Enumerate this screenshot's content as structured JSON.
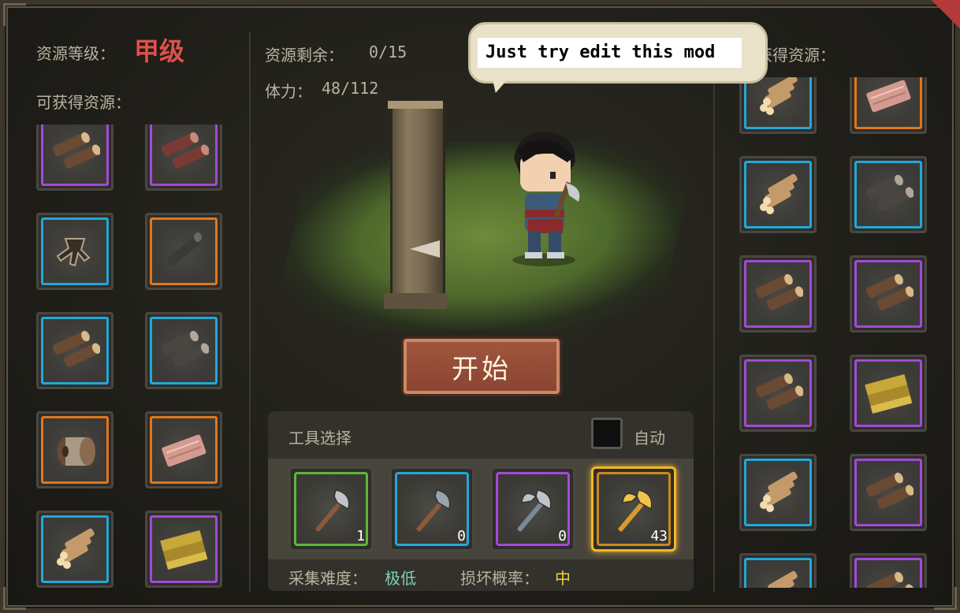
{
  "left_panel": {
    "grade_label": "资源等级：",
    "grade_value": "甲级",
    "available_label": "可获得资源：",
    "items": [
      {
        "icon": "log-icon",
        "rarity": "purple"
      },
      {
        "icon": "red-log-icon",
        "rarity": "purple"
      },
      {
        "icon": "root-icon",
        "rarity": "blue"
      },
      {
        "icon": "dark-branch-icon",
        "rarity": "orange"
      },
      {
        "icon": "log-icon",
        "rarity": "blue"
      },
      {
        "icon": "dark-log-icon",
        "rarity": "blue"
      },
      {
        "icon": "rope-spool-icon",
        "rarity": "orange"
      },
      {
        "icon": "pink-wood-plank-icon",
        "rarity": "orange"
      },
      {
        "icon": "log-pile-icon",
        "rarity": "blue"
      },
      {
        "icon": "gold-wood-plank-icon",
        "rarity": "purple"
      }
    ]
  },
  "center": {
    "remaining_label": "资源剩余：",
    "remaining_value": "0/15",
    "stamina_label": "体力：",
    "stamina_value": "48/112",
    "speech_text": "Just try edit this mod",
    "start_button": "开始",
    "tool_section": {
      "title": "工具选择",
      "auto_label": "自动",
      "auto_checked": false,
      "tools": [
        {
          "icon": "iron-axe-icon",
          "rarity": "green",
          "count": "1"
        },
        {
          "icon": "steel-axe-icon",
          "rarity": "blue",
          "count": "0"
        },
        {
          "icon": "battle-axe-icon",
          "rarity": "purple",
          "count": "0"
        },
        {
          "icon": "golden-axe-icon",
          "rarity": "gold",
          "count": "43",
          "selected": true
        }
      ],
      "difficulty_label": "采集难度：",
      "difficulty_value": "极低",
      "break_label": "损坏概率：",
      "break_value": "中"
    }
  },
  "right_panel": {
    "obtained_label": "已获得资源：",
    "items": [
      {
        "icon": "log-pile-icon",
        "rarity": "blue"
      },
      {
        "icon": "pink-wood-plank-icon",
        "rarity": "orange"
      },
      {
        "icon": "log-pile-icon",
        "rarity": "blue"
      },
      {
        "icon": "dark-log-icon",
        "rarity": "blue"
      },
      {
        "icon": "log-icon",
        "rarity": "purple"
      },
      {
        "icon": "log-icon",
        "rarity": "purple"
      },
      {
        "icon": "log-icon",
        "rarity": "purple"
      },
      {
        "icon": "gold-wood-plank-icon",
        "rarity": "purple"
      },
      {
        "icon": "log-pile-icon",
        "rarity": "blue"
      },
      {
        "icon": "log-icon",
        "rarity": "purple"
      },
      {
        "icon": "log-pile-icon",
        "rarity": "blue"
      },
      {
        "icon": "log-icon",
        "rarity": "purple"
      }
    ]
  },
  "colors": {
    "grade": "#e0504a",
    "difficulty": "#7fd0b8",
    "break": "#f0d23a",
    "purple": "#a24ad8",
    "blue": "#22a8d8",
    "orange": "#e0771c",
    "green": "#5bb83a",
    "gold": "#f0b62a"
  }
}
